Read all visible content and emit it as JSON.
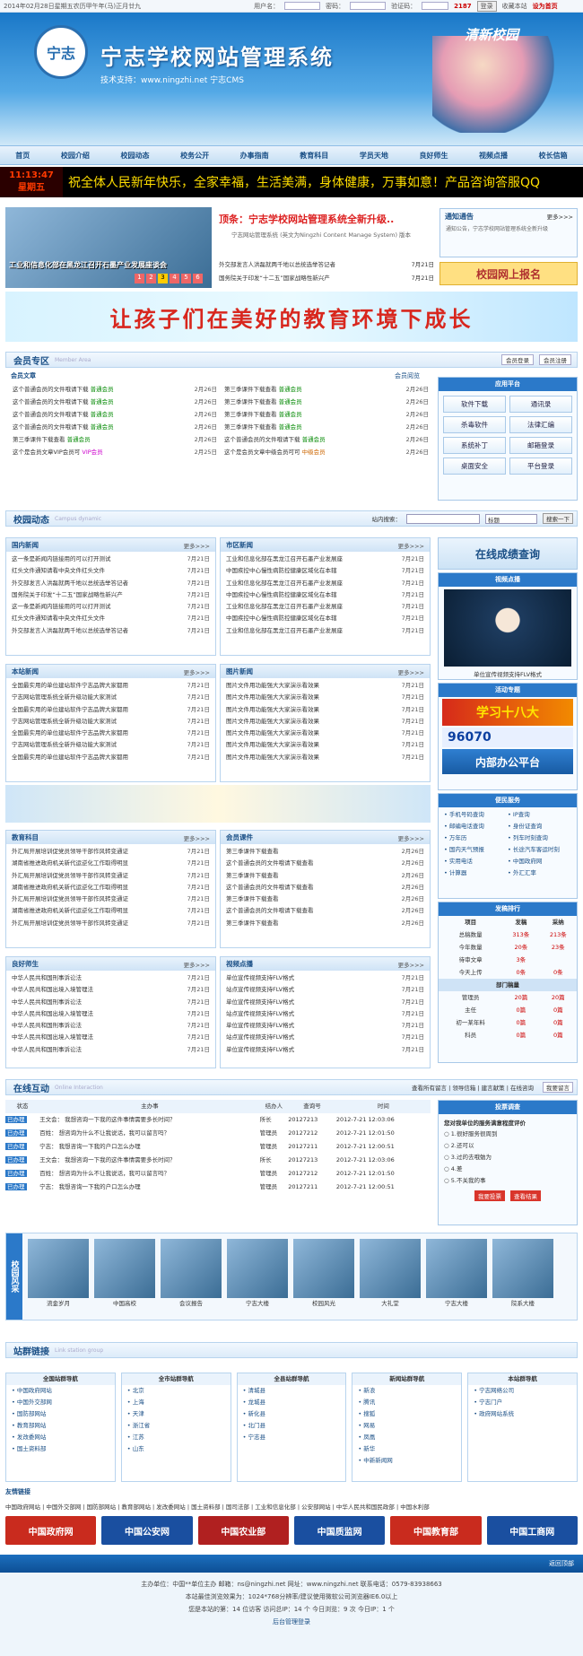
{
  "topbar": {
    "date": "2014年02月28日星期五农历甲午年(马)正月廿九",
    "user_label": "用户名：",
    "pass_label": "密码：",
    "code_label": "验证码：",
    "code_value": "2187",
    "login": "登录",
    "fav": "收藏本站",
    "home": "设为首页"
  },
  "header": {
    "logo_text": "宁志",
    "title": "宁志学校网站管理系统",
    "support": "技术支持：www.ningzhi.net 宁志CMS",
    "brand": "清新校园"
  },
  "nav": [
    "首页",
    "校园介绍",
    "校园动态",
    "校务公开",
    "办事指南",
    "教育科目",
    "学员天地",
    "良好师生",
    "视频点播",
    "校长信箱"
  ],
  "clock": {
    "time": "11:13:47",
    "day": "星期五"
  },
  "marquee": "祝全体人民新年快乐，全家幸福，生活美满，身体健康，万事如意！产品咨询答服QQ",
  "slide": {
    "caption": "工业和信息化部在黑龙江召开石墨产业发展座谈会",
    "nums": [
      "1",
      "2",
      "3",
      "4",
      "5",
      "6"
    ]
  },
  "headline": {
    "title": "顶条：宁志学校网站管理系统全新升级..",
    "desc": "宁志网站管理系统 (英文为Ningzhi Content Manage System) 版本"
  },
  "top_news": [
    {
      "t": "外交部发言人洪磊就两千地以总统选举答记者",
      "d": "7月21日"
    },
    {
      "t": "国务院关于印发“十二五”国家战略性新兴产",
      "d": "7月21日"
    }
  ],
  "notice": {
    "title": "通知通告",
    "more": "更多>>>",
    "text": "通知公告，宁志学校网站管理系统全新升级"
  },
  "enroll": "校园网上报名",
  "banner": "让孩子们在美好的教育环境下成长",
  "member": {
    "title": "会员专区",
    "en": "Member Area",
    "login": "会员登录",
    "register": "会员注册",
    "left_head": "会员文章",
    "right_head": "会员阅览",
    "left": [
      {
        "t": "这个普通会员的文件哦请下载",
        "tag": "普通会员",
        "d": "2月26日"
      },
      {
        "t": "这个普通会员的文件哦请下载",
        "tag": "普通会员",
        "d": "2月26日"
      },
      {
        "t": "这个普通会员的文件哦请下载",
        "tag": "普通会员",
        "d": "2月26日"
      },
      {
        "t": "这个普通会员的文件哦请下载",
        "tag": "普通会员",
        "d": "2月26日"
      },
      {
        "t": "第三季课件下载查看",
        "tag": "普通会员",
        "d": "2月26日"
      },
      {
        "t": "这个是会员文章VIP会员可",
        "tag": "VIP会员",
        "d": "2月25日"
      }
    ],
    "right": [
      {
        "t": "第三季课件下载查看",
        "tag": "普通会员",
        "d": "2月26日"
      },
      {
        "t": "第三季课件下载查看",
        "tag": "普通会员",
        "d": "2月26日"
      },
      {
        "t": "第三季课件下载查看",
        "tag": "普通会员",
        "d": "2月26日"
      },
      {
        "t": "第三季课件下载查看",
        "tag": "普通会员",
        "d": "2月26日"
      },
      {
        "t": "这个普通会员的文件哦请下载",
        "tag": "普通会员",
        "d": "2月26日"
      },
      {
        "t": "这个是会员文章中级会员可可",
        "tag": "中级会员",
        "d": "2月26日"
      }
    ]
  },
  "apps": {
    "title": "应用平台",
    "items": [
      "软件下载",
      "通讯录",
      "杀毒软件",
      "法律汇编",
      "系统补丁",
      "邮箱登录",
      "桌面安全",
      "平台登录"
    ]
  },
  "campus": {
    "title": "校园动态",
    "en": "Campus dynamic",
    "search_label": "站内搜索：",
    "select": "标题",
    "search_btn": "搜索一下"
  },
  "panels": [
    {
      "title": "国内新闻",
      "more": "更多>>>",
      "items": [
        "这一条是新闻内链接用的可以打开测试",
        "红头文件通知请看中央文件红头文件",
        "外交部发言人洪磊就两千地以总统选举答记者",
        "国务院关于印发“十二五”国家战略性新兴产",
        "这一条是新闻内链接用的可以打开测试",
        "红头文件通知请看中央文件红头文件",
        "外交部发言人洪磊就两千地以总统选举答记者"
      ],
      "date": "7月21日"
    },
    {
      "title": "市区新闻",
      "more": "更多>>>",
      "items": [
        "工业和信息化部在黑龙江召开石墨产业发展座",
        "中国疾控中心慢性病防控健康区域化在本辖",
        "工业和信息化部在黑龙江召开石墨产业发展座",
        "中国疾控中心慢性病防控健康区域化在本辖",
        "工业和信息化部在黑龙江召开石墨产业发展座",
        "中国疾控中心慢性病防控健康区域化在本辖",
        "工业和信息化部在黑龙江召开石墨产业发展座"
      ],
      "date": "7月21日"
    },
    {
      "title": "本站新闻",
      "more": "更多>>>",
      "items": [
        "全国最实用的单位建站软件宁志品牌大家都用",
        "宁志网站管理系统全新升级功能大家测试",
        "全国最实用的单位建站软件宁志品牌大家都用",
        "宁志网站管理系统全新升级功能大家测试",
        "全国最实用的单位建站软件宁志品牌大家都用",
        "宁志网站管理系统全新升级功能大家测试",
        "全国最实用的单位建站软件宁志品牌大家都用"
      ],
      "date": "7月21日"
    },
    {
      "title": "图片新闻",
      "more": "更多>>>",
      "items": [
        "图片文件用功能强大大家演示看效果",
        "图片文件用功能强大大家演示看效果",
        "图片文件用功能强大大家演示看效果",
        "图片文件用功能强大大家演示看效果",
        "图片文件用功能强大大家演示看效果",
        "图片文件用功能强大大家演示看效果",
        "图片文件用功能强大大家演示看效果"
      ],
      "date": "7月21日"
    },
    {
      "title": "教育科目",
      "more": "更多>>>",
      "items": [
        "外汇局开展培训促党员领导干部作风转变通证",
        "湖南省推进政府机关新代运逆化工作取得明显",
        "外汇局开展培训促党员领导干部作风转变通证",
        "湖南省推进政府机关新代运逆化工作取得明显",
        "外汇局开展培训促党员领导干部作风转变通证",
        "湖南省推进政府机关新代运逆化工作取得明显",
        "外汇局开展培训促党员领导干部作风转变通证"
      ],
      "date": "7月21日"
    },
    {
      "title": "会员课件",
      "more": "更多>>>",
      "items": [
        "第三季课件下载查看",
        "这个普通会员的文件哦请下载查看",
        "第三季课件下载查看",
        "这个普通会员的文件哦请下载查看",
        "第三季课件下载查看",
        "这个普通会员的文件哦请下载查看",
        "第三季课件下载查看"
      ],
      "date": "2月26日"
    },
    {
      "title": "良好师生",
      "more": "更多>>>",
      "items": [
        "中华人民共和国刑事诉讼法",
        "中华人民共和国出境入境管理法",
        "中华人民共和国刑事诉讼法",
        "中华人民共和国出境入境管理法",
        "中华人民共和国刑事诉讼法",
        "中华人民共和国出境入境管理法",
        "中华人民共和国刑事诉讼法"
      ],
      "date": "7月21日"
    },
    {
      "title": "视频点播",
      "more": "更多>>>",
      "items": [
        "单位宣传视频支持FLV格式",
        "站点宣传视频支持FLV格式",
        "单位宣传视频支持FLV格式",
        "站点宣传视频支持FLV格式",
        "单位宣传视频支持FLV格式",
        "站点宣传视频支持FLV格式",
        "单位宣传视频支持FLV格式"
      ],
      "date": "7月21日"
    }
  ],
  "sidebar": {
    "score": "在线成绩查询",
    "video_head": "视频点播",
    "video_cap": "单位宣传视频支持FLV格式",
    "activity_head": "活动专题",
    "study": "学习十八大",
    "hotline": "96070",
    "office": "内部办公平台",
    "service_head": "便民服务",
    "service": [
      "手机号码查询",
      "IP查询",
      "邮编电话查询",
      "身份证查询",
      "万年历",
      "列车时刻查询",
      "国内天气预报",
      "长途汽车客运时刻",
      "实用电话",
      "中国政府网",
      "计算器",
      "外汇汇率"
    ],
    "rank_head": "发稿排行",
    "rank_cols": [
      "项目",
      "发稿",
      "采纳"
    ],
    "rank_rows": [
      [
        "总稿数量",
        "313条",
        "213条"
      ],
      [
        "今年数量",
        "20条",
        "23条"
      ],
      [
        "待审文章",
        "3条",
        ""
      ],
      [
        "今天上传",
        "0条",
        "0条"
      ]
    ],
    "dept_head": "部门稿量",
    "dept_rows": [
      [
        "管理员",
        "20篇",
        "20篇"
      ],
      [
        "主任",
        "0篇",
        "0篇"
      ],
      [
        "初一某年料",
        "0篇",
        "0篇"
      ],
      [
        "科员",
        "0篇",
        "0篇"
      ]
    ]
  },
  "online": {
    "title": "在线互动",
    "en": "Online Interaction",
    "links": "查看所有留言 | 领导信箱 | 建言献策 | 在线咨询",
    "post": "我要留言",
    "cols": [
      "状态",
      "主办事",
      "结办人",
      "查询号",
      "时间"
    ],
    "rows": [
      {
        "s": "已办理",
        "t": "王文会： 我想咨询一下我的这件事情需要多长时间？",
        "p": "所长",
        "n": "20127213",
        "d": "2012-7-21 12:03:06"
      },
      {
        "s": "已办理",
        "t": "百姓： 想咨询为什么不让我说话，我可以留言吗？",
        "p": "管理员",
        "n": "20127212",
        "d": "2012-7-21 12:01:50"
      },
      {
        "s": "已办理",
        "t": "宁志： 我想咨询一下我的户口怎么办理",
        "p": "管理员",
        "n": "20127211",
        "d": "2012-7-21 12:00:51"
      },
      {
        "s": "已办理",
        "t": "王文会： 我想咨询一下我的这件事情需要多长时间？",
        "p": "所长",
        "n": "20127213",
        "d": "2012-7-21 12:03:06"
      },
      {
        "s": "已办理",
        "t": "百姓： 想咨询为什么不让我说话，我可以留言吗？",
        "p": "管理员",
        "n": "20127212",
        "d": "2012-7-21 12:01:50"
      },
      {
        "s": "已办理",
        "t": "宁志： 我想咨询一下我的户口怎么办理",
        "p": "管理员",
        "n": "20127211",
        "d": "2012-7-21 12:00:51"
      }
    ]
  },
  "vote": {
    "head": "投票调查",
    "q": "您对我单位的服务满意程度评价",
    "opts": [
      "1.很好服务很周到",
      "2.还可以",
      "3.过的去哦勉为",
      "4.差",
      "5.不关我的事"
    ],
    "submit": "我要投票",
    "view": "查看结果"
  },
  "gallery": {
    "label": "校园风采",
    "caps": [
      "流金岁月",
      "中国高校",
      "会议报告",
      "宁志大楼",
      "校园风光",
      "大礼堂",
      "宁志大楼",
      "院系大楼"
    ]
  },
  "friends": {
    "title": "站群链接",
    "en": "Link station group",
    "cols": [
      {
        "h": "全国站群导航",
        "items": [
          "中国政府网站",
          "中国外交部网",
          "国防部网站",
          "教育部网站",
          "发改委网站",
          "国土资料部"
        ]
      },
      {
        "h": "全市站群导航",
        "items": [
          "北京",
          "上海",
          "天津",
          "浙江省",
          "江苏",
          "山东"
        ]
      },
      {
        "h": "全县站群导航",
        "items": [
          "清城县",
          "龙城县",
          "新化县",
          "北门县",
          "宁志县"
        ]
      },
      {
        "h": "新闻站群导航",
        "items": [
          "新浪",
          "腾讯",
          "搜狐",
          "网易",
          "凤凰",
          "新华",
          "中新新闻网"
        ]
      },
      {
        "h": "本站群导航",
        "items": [
          "宁志网络公司",
          "宁志门户",
          "政府网站系统"
        ]
      }
    ]
  },
  "links_head": "友情链接",
  "links": "中国政府网站 | 中国外交部网 | 国防部网站 | 教育部网站 | 发改委网站 | 国土资料部 | 国司法部 | 工业和信息化部 | 公安部网站 | 中华人民共和国民政部 | 中国水利部",
  "logos": [
    "中国政府网",
    "中国公安网",
    "中国农业部",
    "中国质监网",
    "中国教育部",
    "中国工商网"
  ],
  "top_btn": "返回顶部",
  "footer": {
    "l1": "主办单位：中国**单位主办   邮箱：ns@ningzhi.net   网址：www.ningzhi.net   联系电话：0579-83938663",
    "l2": "本站最佳浏览效果为：1024*768分辨率/建议使用微软公司浏览器IE6.0以上",
    "l3": "您是本站的第：14 位访客    访问总IP：14 个    今日浏览：9 次    今日IP：1 个",
    "admin": "后台管理登录"
  }
}
